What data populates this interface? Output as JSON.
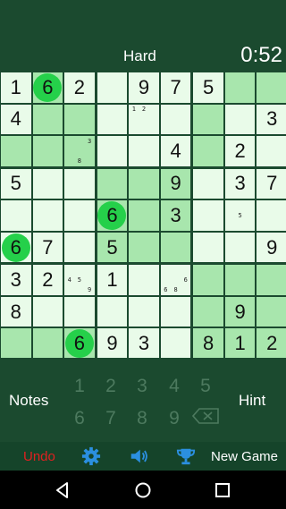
{
  "header": {
    "difficulty": "Hard",
    "timer": "0:52"
  },
  "colors": {
    "dark_green": "#1b4a2f",
    "cell_light": "#e9fbe9",
    "cell_green": "#a8e6ad",
    "cell_mid": "#c9f1cc",
    "highlight_circle": "#25d04a",
    "undo_red": "#e02020",
    "accent_blue": "#2b8fe0"
  },
  "board": {
    "givens": [
      [
        1,
        6,
        2,
        0,
        9,
        7,
        5,
        0,
        0
      ],
      [
        4,
        0,
        0,
        0,
        0,
        0,
        0,
        0,
        3
      ],
      [
        0,
        0,
        0,
        0,
        0,
        4,
        0,
        2,
        0
      ],
      [
        5,
        0,
        0,
        0,
        0,
        9,
        0,
        3,
        7
      ],
      [
        0,
        0,
        0,
        6,
        0,
        3,
        0,
        0,
        0
      ],
      [
        6,
        7,
        0,
        5,
        0,
        0,
        0,
        0,
        9
      ],
      [
        3,
        2,
        0,
        1,
        0,
        0,
        0,
        0,
        0
      ],
      [
        8,
        0,
        0,
        0,
        0,
        0,
        0,
        9,
        0
      ],
      [
        0,
        0,
        6,
        9,
        3,
        0,
        8,
        1,
        2
      ]
    ],
    "shades": [
      [
        "L",
        "G",
        "L",
        "L",
        "L",
        "L",
        "L",
        "G",
        "G"
      ],
      [
        "L",
        "G",
        "G",
        "L",
        "L",
        "L",
        "G",
        "L",
        "L"
      ],
      [
        "G",
        "G",
        "G",
        "L",
        "L",
        "L",
        "G",
        "L",
        "L"
      ],
      [
        "L",
        "L",
        "L",
        "G",
        "G",
        "G",
        "L",
        "L",
        "L"
      ],
      [
        "L",
        "L",
        "L",
        "G",
        "G",
        "G",
        "L",
        "L",
        "L"
      ],
      [
        "L",
        "L",
        "L",
        "G",
        "G",
        "G",
        "L",
        "L",
        "L"
      ],
      [
        "L",
        "L",
        "L",
        "L",
        "L",
        "L",
        "G",
        "G",
        "G"
      ],
      [
        "L",
        "L",
        "L",
        "L",
        "L",
        "L",
        "G",
        "G",
        "G"
      ],
      [
        "G",
        "G",
        "G",
        "L",
        "L",
        "L",
        "G",
        "G",
        "G"
      ]
    ],
    "highlighted": [
      [
        0,
        1
      ],
      [
        4,
        3
      ],
      [
        5,
        0
      ],
      [
        8,
        2
      ]
    ],
    "notes": [
      {
        "row": 1,
        "col": 4,
        "digits": [
          1,
          2
        ]
      },
      {
        "row": 2,
        "col": 2,
        "digits": [
          3,
          8
        ]
      },
      {
        "row": 4,
        "col": 7,
        "digits": [
          5
        ]
      },
      {
        "row": 6,
        "col": 2,
        "digits": [
          4,
          5,
          9
        ]
      },
      {
        "row": 6,
        "col": 5,
        "digits": [
          6,
          6,
          8
        ]
      }
    ]
  },
  "controls": {
    "notes_label": "Notes",
    "hint_label": "Hint",
    "numbers": [
      "1",
      "2",
      "3",
      "4",
      "5",
      "6",
      "7",
      "8",
      "9"
    ]
  },
  "toolbar": {
    "undo_label": "Undo",
    "new_game_label": "New Game",
    "icons": [
      "gear-icon",
      "speaker-icon",
      "trophy-icon"
    ]
  },
  "navbar": {
    "icons": [
      "back-icon",
      "home-icon",
      "recents-icon"
    ]
  }
}
